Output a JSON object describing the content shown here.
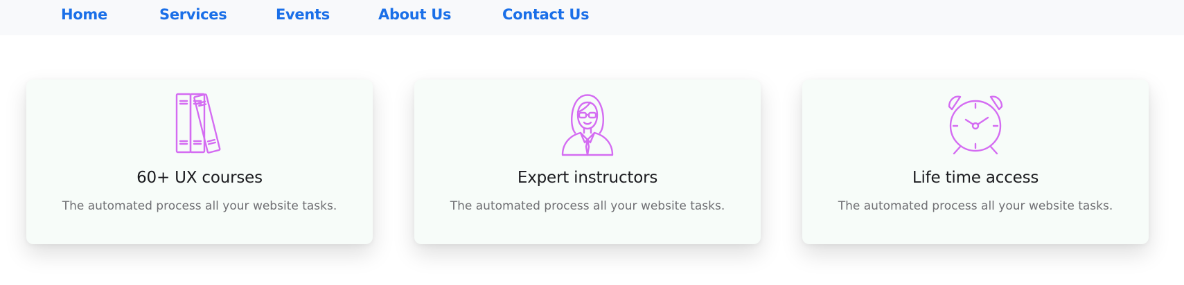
{
  "nav": {
    "items": [
      {
        "label": "Home"
      },
      {
        "label": "Services"
      },
      {
        "label": "Events"
      },
      {
        "label": "About Us"
      },
      {
        "label": "Contact Us"
      }
    ]
  },
  "features": {
    "cards": [
      {
        "icon": "books-icon",
        "title": "60+ UX courses",
        "description": "The automated process all your website tasks."
      },
      {
        "icon": "instructor-icon",
        "title": "Expert instructors",
        "description": "The automated process all your website tasks."
      },
      {
        "icon": "alarm-clock-icon",
        "title": "Life time access",
        "description": "The automated process all your website tasks."
      }
    ]
  },
  "colors": {
    "nav_link": "#1a6fe8",
    "icon_accent": "#d46cf2",
    "card_background": "#f7fcf9",
    "title_text": "#1b1b1f",
    "description_text": "#6f6f73"
  }
}
